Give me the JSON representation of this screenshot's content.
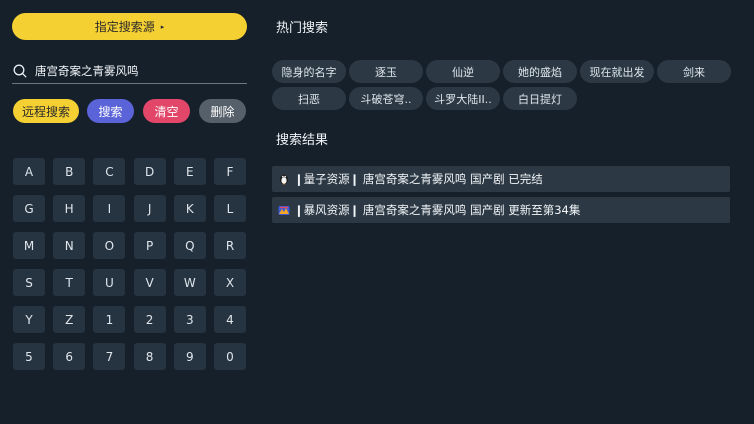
{
  "source": {
    "label": "指定搜索源",
    "arrow": "▸"
  },
  "search": {
    "value": "唐宫奇案之青雾风鸣"
  },
  "actions": [
    {
      "label": "远程搜索",
      "bg": "#f5d033",
      "fg": "#2a2a2a"
    },
    {
      "label": "搜索",
      "bg": "#5b63d9",
      "fg": "#ffffff"
    },
    {
      "label": "清空",
      "bg": "#e2476a",
      "fg": "#ffffff"
    },
    {
      "label": "删除",
      "bg": "#56606a",
      "fg": "#ffffff"
    }
  ],
  "keyboard": [
    [
      "A",
      "B",
      "C",
      "D",
      "E",
      "F"
    ],
    [
      "G",
      "H",
      "I",
      "J",
      "K",
      "L"
    ],
    [
      "M",
      "N",
      "O",
      "P",
      "Q",
      "R"
    ],
    [
      "S",
      "T",
      "U",
      "V",
      "W",
      "X"
    ],
    [
      "Y",
      "Z",
      "1",
      "2",
      "3",
      "4"
    ],
    [
      "5",
      "6",
      "7",
      "8",
      "9",
      "0"
    ]
  ],
  "hot": {
    "title": "热门搜索",
    "items": [
      "隐身的名字",
      "逐玉",
      "仙逆",
      "她的盛焰",
      "现在就出发",
      "剑来",
      "扫恶",
      "斗破苍穹..",
      "斗罗大陆II..",
      "白日提灯"
    ]
  },
  "results": {
    "title": "搜索结果",
    "items": [
      {
        "icon": "penguin-icon",
        "text": "❙量子资源❙  唐宫奇案之青雾风鸣 国产剧 已完结"
      },
      {
        "icon": "storm-icon",
        "text": "❙暴风资源❙  唐宫奇案之青雾风鸣 国产剧 更新至第34集"
      }
    ]
  }
}
